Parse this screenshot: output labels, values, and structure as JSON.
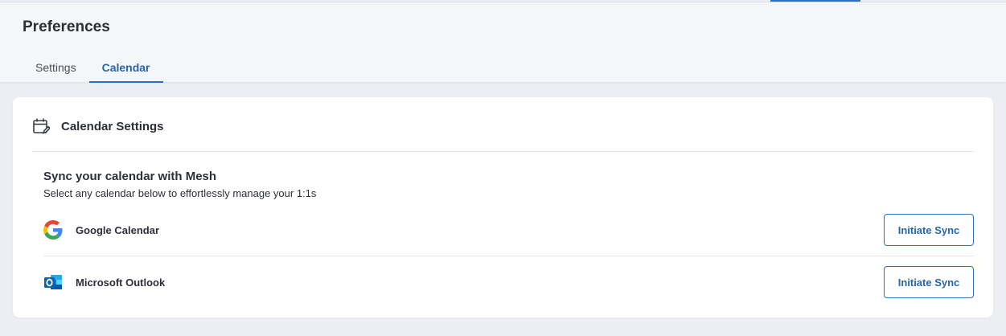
{
  "page": {
    "title": "Preferences"
  },
  "tabs": [
    {
      "label": "Settings",
      "active": false
    },
    {
      "label": "Calendar",
      "active": true
    }
  ],
  "card": {
    "title": "Calendar Settings",
    "icon": "calendar-edit-icon",
    "sync_title": "Sync your calendar with Mesh",
    "sync_subtitle": "Select any calendar below to effortlessly manage your 1:1s",
    "providers": [
      {
        "name": "Google Calendar",
        "icon": "google-icon",
        "button": "Initiate Sync"
      },
      {
        "name": "Microsoft Outlook",
        "icon": "outlook-icon",
        "button": "Initiate Sync"
      }
    ]
  },
  "colors": {
    "accent": "#2f6fbf",
    "background": "#eceef3",
    "card": "#ffffff"
  }
}
